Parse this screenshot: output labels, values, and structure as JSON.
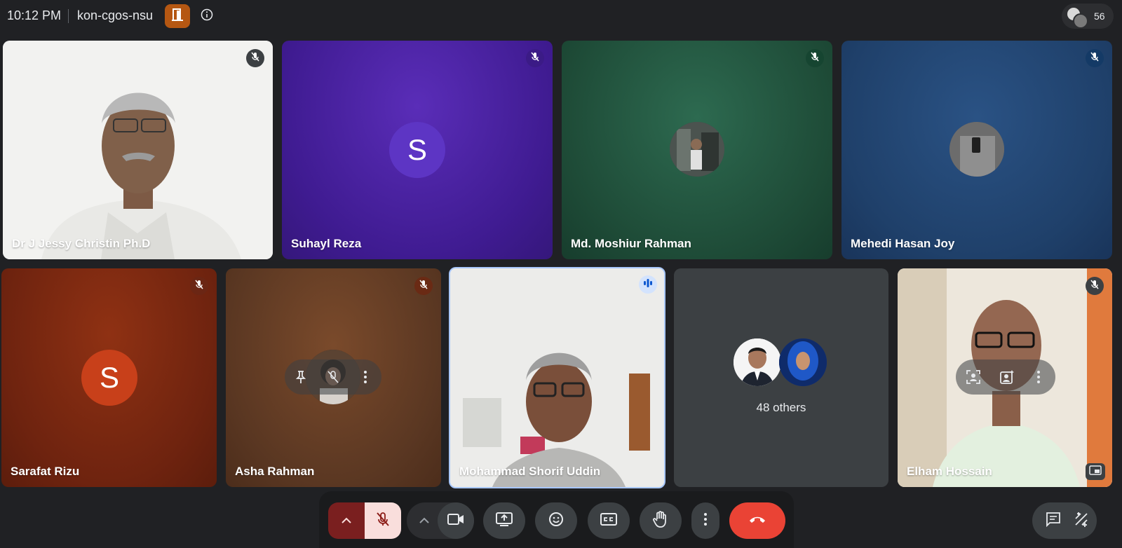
{
  "topbar": {
    "time": "10:12 PM",
    "meeting_code": "kon-cgos-nsu",
    "participant_count": "56"
  },
  "tiles": [
    {
      "name": "Dr J Jessy Christin Ph.D",
      "type": "video"
    },
    {
      "name": "Suhayl Reza",
      "type": "letter",
      "letter": "S",
      "bg": "#4a21a8"
    },
    {
      "name": "Md. Moshiur Rahman",
      "type": "photo",
      "bg": "#1f4a38"
    },
    {
      "name": "Mehedi Hasan Joy",
      "type": "photo",
      "bg": "#1e3f68"
    },
    {
      "name": "Sarafat Rizu",
      "type": "letter",
      "letter": "S",
      "bg": "#6e220f"
    },
    {
      "name": "Asha Rahman",
      "type": "photo",
      "bg": "#5a3722"
    },
    {
      "name": "Mohammad Shorif Uddin",
      "type": "video",
      "speaking": true
    },
    {
      "others_label": "48 others",
      "type": "others",
      "bg": "#3c4043"
    },
    {
      "name": "Elham Hossain",
      "type": "video"
    }
  ],
  "colors": {
    "background": "#202124",
    "end_call": "#ea4335",
    "mic_off": "#f9dedc",
    "speaking_outline": "#a8c7fa"
  },
  "controls": [
    {
      "icon": "chevron-up-icon",
      "state": "active"
    },
    {
      "icon": "mic-off-icon",
      "state": "off"
    },
    {
      "icon": "chevron-up-icon"
    },
    {
      "icon": "camera-icon"
    },
    {
      "icon": "present-icon"
    },
    {
      "icon": "emoji-icon"
    },
    {
      "icon": "captions-icon"
    },
    {
      "icon": "raise-hand-icon"
    },
    {
      "icon": "more-vert-icon"
    },
    {
      "icon": "end-call-icon"
    }
  ],
  "side_controls": [
    {
      "icon": "chat-icon"
    },
    {
      "icon": "activities-icon"
    }
  ]
}
